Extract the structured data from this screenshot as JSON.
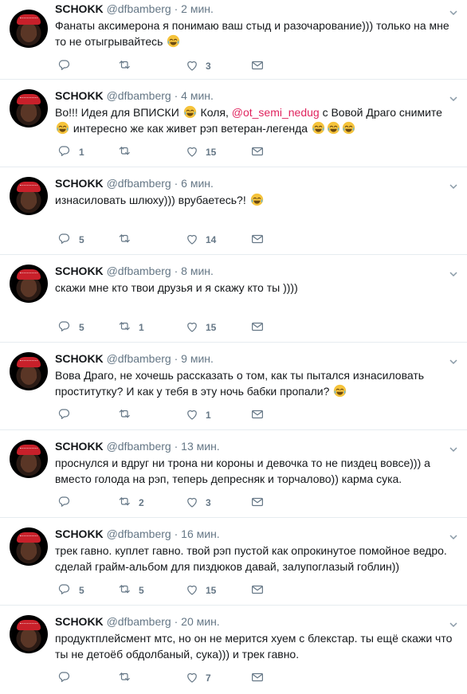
{
  "tweets": [
    {
      "name": "SCHOKK",
      "handle": "@dfbamberg",
      "time": "2 мин.",
      "segments": [
        {
          "t": "Фанаты аксимерона я понимаю ваш стыд и разочарование))) только на мне то не отыгрывайтесь "
        },
        {
          "emoji": "joy"
        }
      ],
      "replies": "",
      "retweets": "",
      "likes": "3"
    },
    {
      "name": "SCHOKK",
      "handle": "@dfbamberg",
      "time": "4 мин.",
      "segments": [
        {
          "t": "Во!!! Идея для ВПИСКИ "
        },
        {
          "emoji": "joy"
        },
        {
          "t": " Коля, "
        },
        {
          "mention": "@ot_semi_nedug"
        },
        {
          "t": " с Вовой Драго снимите "
        },
        {
          "emoji": "joy"
        },
        {
          "t": " интересно же как живет рэп ветеран-легенда "
        },
        {
          "emoji": "joy"
        },
        {
          "emoji": "joy"
        },
        {
          "emoji": "joy"
        }
      ],
      "replies": "1",
      "retweets": "",
      "likes": "15"
    },
    {
      "name": "SCHOKK",
      "handle": "@dfbamberg",
      "time": "6 мин.",
      "segments": [
        {
          "t": "изнасиловать шлюху))) врубаетесь?! "
        },
        {
          "emoji": "joy"
        }
      ],
      "replies": "5",
      "retweets": "",
      "likes": "14"
    },
    {
      "name": "SCHOKK",
      "handle": "@dfbamberg",
      "time": "8 мин.",
      "segments": [
        {
          "t": "скажи мне кто твои друзья и я скажу кто ты ))))"
        }
      ],
      "replies": "5",
      "retweets": "1",
      "likes": "15"
    },
    {
      "name": "SCHOKK",
      "handle": "@dfbamberg",
      "time": "9 мин.",
      "segments": [
        {
          "t": "Вова Драго, не хочешь рассказать о том, как ты пытался изнасиловать проститутку? И как у тебя в эту ночь бабки пропали? "
        },
        {
          "emoji": "joy"
        }
      ],
      "replies": "",
      "retweets": "",
      "likes": "1"
    },
    {
      "name": "SCHOKK",
      "handle": "@dfbamberg",
      "time": "13 мин.",
      "segments": [
        {
          "t": "проснулся и вдруг ни трона ни короны и  девочка то не пиздец вовсе))) а вместо голода на рэп, теперь депресняк и торчалово)) карма сука."
        }
      ],
      "replies": "",
      "retweets": "2",
      "likes": "3"
    },
    {
      "name": "SCHOKK",
      "handle": "@dfbamberg",
      "time": "16 мин.",
      "segments": [
        {
          "t": "трек гавно. куплет гавно. твой рэп пустой как опрокинутое помойное ведро. сделай грайм-альбом для пиздюков давай, залупоглазый гоблин))"
        }
      ],
      "replies": "5",
      "retweets": "5",
      "likes": "15"
    },
    {
      "name": "SCHOKK",
      "handle": "@dfbamberg",
      "time": "20 мин.",
      "segments": [
        {
          "t": "продуктплейсмент мтс, но он не мерится хуем с блекстар. ты ещё скажи что ты не детоёб обдолбаный, сука))) и трек гавно."
        }
      ],
      "replies": "",
      "retweets": "",
      "likes": "7"
    }
  ],
  "icons": {
    "reply": "reply-icon",
    "retweet": "retweet-icon",
    "like": "heart-icon",
    "dm": "direct-message-icon",
    "emoji": "face-with-tears-of-joy-emoji",
    "avatar": "avatar"
  },
  "colors": {
    "text": "#14171a",
    "muted": "#657786",
    "mention": "#e0245e",
    "divider": "#e6ecf0",
    "emoji": "#f5c33b"
  }
}
